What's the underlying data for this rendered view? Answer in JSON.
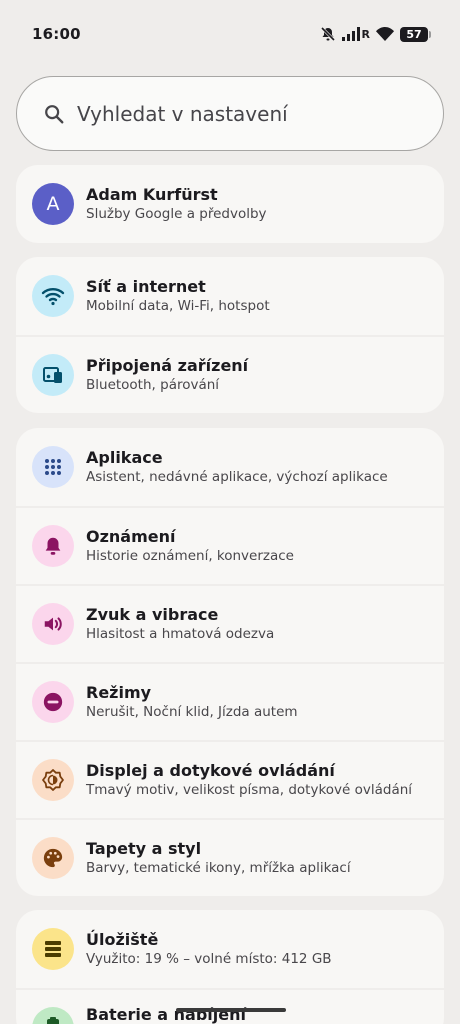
{
  "status": {
    "time": "16:00",
    "network_letter": "R",
    "battery": "57"
  },
  "search": {
    "placeholder": "Vyhledat v nastavení"
  },
  "account": {
    "initial": "A",
    "name": "Adam Kurfürst",
    "subtitle": "Služby Google a předvolby"
  },
  "connectivity": [
    {
      "title": "Síť a internet",
      "subtitle": "Mobilní data, Wi-Fi, hotspot",
      "icon": "wifi-icon",
      "bg": "#c3ebf8",
      "fg": "#04506b"
    },
    {
      "title": "Připojená zařízení",
      "subtitle": "Bluetooth, párování",
      "icon": "devices-icon",
      "bg": "#c3ebf8",
      "fg": "#04506b"
    }
  ],
  "general": [
    {
      "title": "Aplikace",
      "subtitle": "Asistent, nedávné aplikace, výchozí aplikace",
      "icon": "apps-grid-icon",
      "bg": "#d8e3fa",
      "fg": "#2b4a8a"
    },
    {
      "title": "Oznámení",
      "subtitle": "Historie oznámení, konverzace",
      "icon": "bell-icon",
      "bg": "#fbd6ec",
      "fg": "#8b1462"
    },
    {
      "title": "Zvuk a vibrace",
      "subtitle": "Hlasitost a hmatová odezva",
      "icon": "speaker-icon",
      "bg": "#fbd6ec",
      "fg": "#8b1462"
    },
    {
      "title": "Režimy",
      "subtitle": "Nerušit, Noční klid, Jízda autem",
      "icon": "do-not-disturb-icon",
      "bg": "#fbd6ec",
      "fg": "#8b1462"
    },
    {
      "title": "Displej a dotykové ovládání",
      "subtitle": "Tmavý motiv, velikost písma, dotykové ovládání",
      "icon": "brightness-icon",
      "bg": "#fbddc7",
      "fg": "#7a3f0e"
    },
    {
      "title": "Tapety a styl",
      "subtitle": "Barvy, tematické ikony, mřížka aplikací",
      "icon": "palette-icon",
      "bg": "#fbddc7",
      "fg": "#7a3f0e"
    }
  ],
  "system": [
    {
      "title": "Úložiště",
      "subtitle": "Využito: 19 % – volné místo: 412 GB",
      "icon": "storage-icon",
      "bg": "#fbe48a",
      "fg": "#4a3c00"
    },
    {
      "title": "Baterie a nabíjení",
      "subtitle": "",
      "icon": "battery-icon",
      "bg": "#bfe9c4",
      "fg": "#1d5a26"
    }
  ]
}
